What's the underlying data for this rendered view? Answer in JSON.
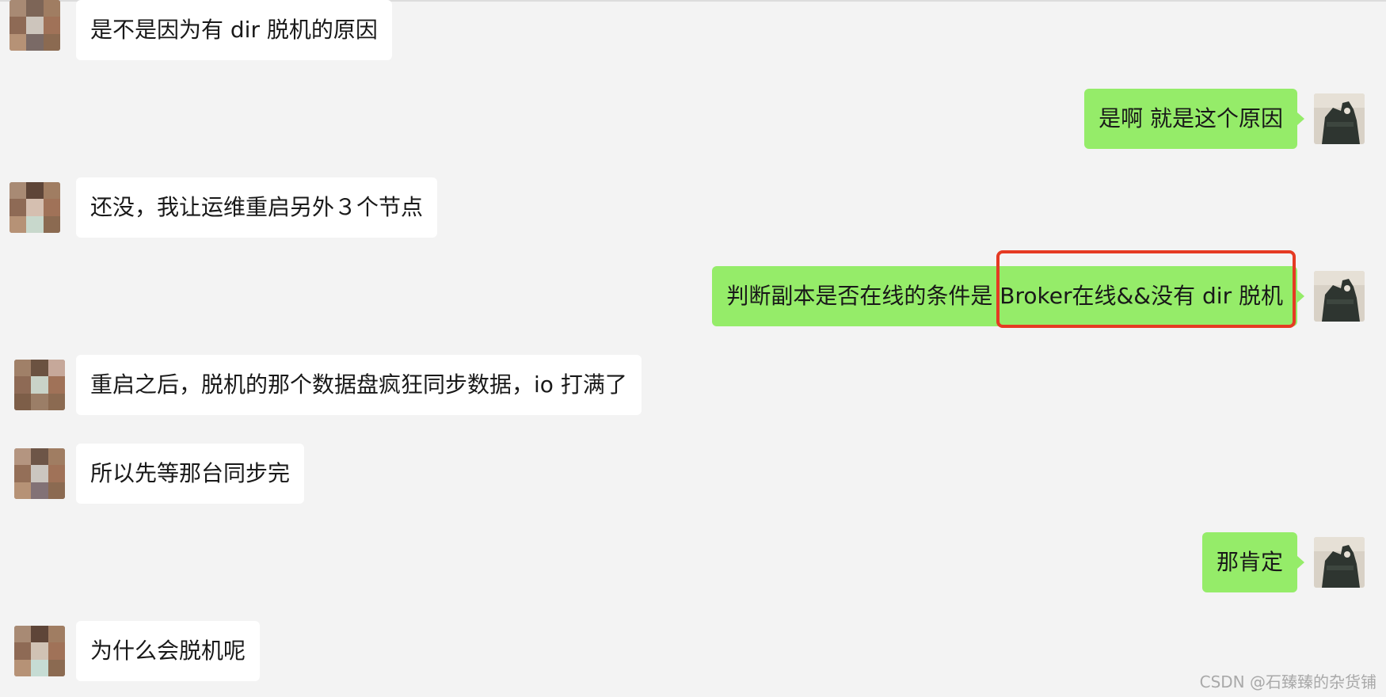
{
  "messages": [
    {
      "side": "left",
      "text": "是不是因为有 dir 脱机的原因"
    },
    {
      "side": "right",
      "text": "是啊  就是这个原因"
    },
    {
      "side": "left",
      "text": "还没，我让运维重启另外３个节点"
    },
    {
      "side": "right",
      "text": "判断副本是否在线的条件是  Broker在线&&没有 dir 脱机"
    },
    {
      "side": "left",
      "text": "重启之后，脱机的那个数据盘疯狂同步数据，io 打满了"
    },
    {
      "side": "left",
      "text": "所以先等那台同步完"
    },
    {
      "side": "right",
      "text": "那肯定"
    },
    {
      "side": "left",
      "text": "为什么会脱机呢"
    }
  ],
  "watermark": "CSDN @石臻臻的杂货铺",
  "colors": {
    "background": "#f3f3f3",
    "incoming_bubble": "#ffffff",
    "outgoing_bubble": "#95ec69",
    "highlight": "#e53a23"
  },
  "icons": {
    "incoming_avatar": "pixelated-avatar-icon",
    "outgoing_avatar": "silhouette-avatar-icon"
  }
}
